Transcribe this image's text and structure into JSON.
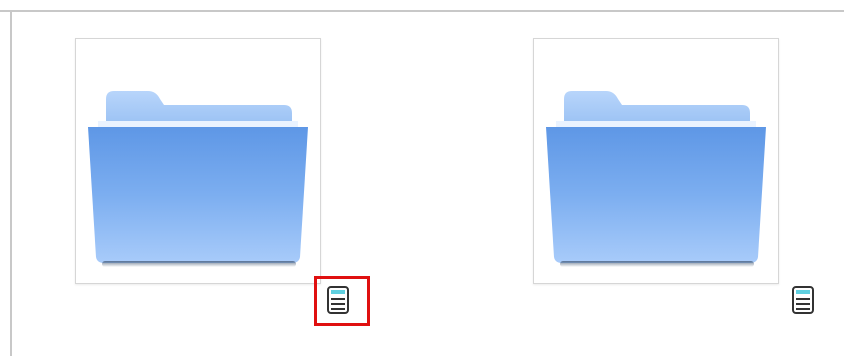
{
  "items": [
    {
      "name": "folder",
      "type": "folder"
    },
    {
      "name": "folder",
      "type": "folder"
    }
  ],
  "icons": {
    "folder": "folder-icon",
    "info": "document-info-icon"
  },
  "colors": {
    "folder_light": "#a9cdfb",
    "folder_mid": "#7fb0f2",
    "folder_dark": "#5b93e6",
    "highlight": "#e01010"
  }
}
